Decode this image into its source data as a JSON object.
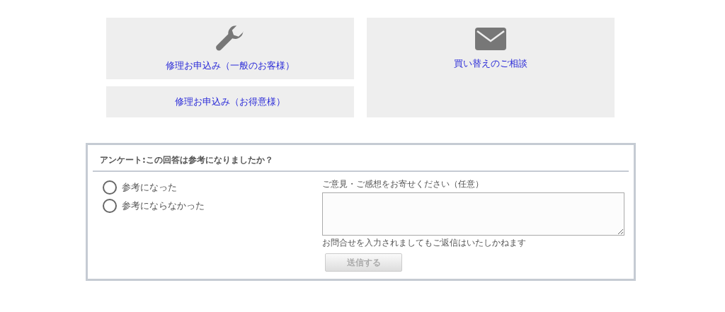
{
  "menu_tiles": [
    {
      "label": "修理お申込み（一般のお客様）",
      "kind": "wrench"
    },
    {
      "label": "修理お申込み（お得意様）",
      "kind": "plain"
    },
    {
      "label": "買い替えのご相談",
      "kind": "mail"
    }
  ],
  "survey": {
    "title": "アンケート:この回答は参考になりましたか？",
    "options": [
      {
        "label": "参考になった",
        "selected": false
      },
      {
        "label": "参考にならなかった",
        "selected": false
      }
    ],
    "comment_label": "ご意見・ご感想をお寄せください（任意）",
    "note": "お問合せを入力されましてもご返信はいたしかねます",
    "submit": {
      "label": "送信する",
      "disabled": true
    }
  }
}
